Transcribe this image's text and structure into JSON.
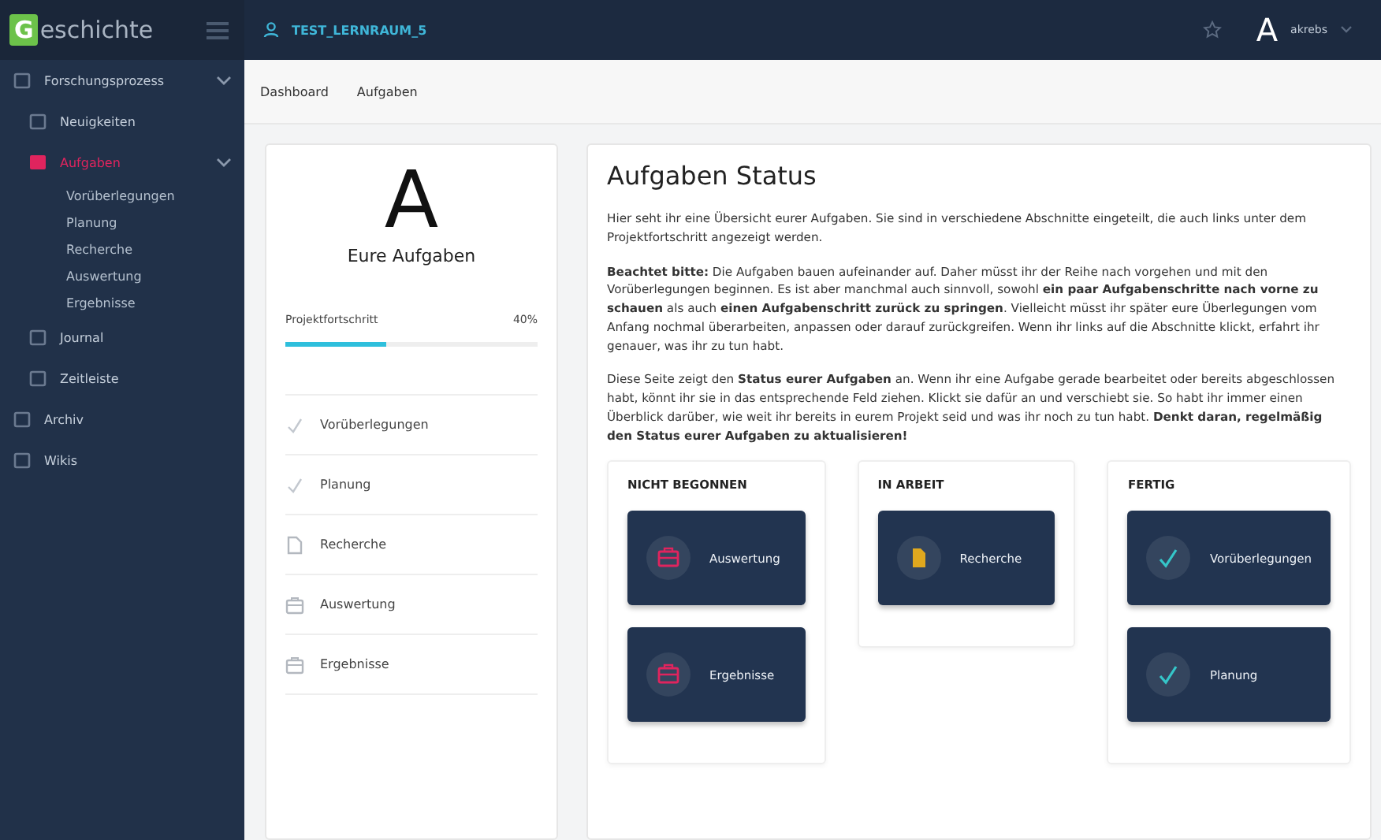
{
  "logo": {
    "initial": "G",
    "rest": "eschichte"
  },
  "topbar": {
    "room": "TEST_LERNRAUM_5",
    "avatar": "A",
    "user": "akrebs"
  },
  "sidebar": {
    "items": [
      {
        "label": "Forschungsprozess",
        "selected": false,
        "expanded": true,
        "children": [
          {
            "label": "Neuigkeiten",
            "selected": false
          },
          {
            "label": "Aufgaben",
            "selected": true,
            "expanded": true,
            "children": [
              {
                "label": "Vorüberlegungen",
                "selected": false
              },
              {
                "label": "Planung",
                "selected": false
              },
              {
                "label": "Recherche",
                "selected": false
              },
              {
                "label": "Auswertung",
                "selected": false
              },
              {
                "label": "Ergebnisse",
                "selected": false
              }
            ]
          },
          {
            "label": "Journal",
            "selected": false
          },
          {
            "label": "Zeitleiste",
            "selected": false
          }
        ]
      },
      {
        "label": "Archiv",
        "selected": false
      },
      {
        "label": "Wikis",
        "selected": false
      }
    ]
  },
  "breadcrumb": [
    "Dashboard",
    "Aufgaben"
  ],
  "summary": {
    "letter": "A",
    "title": "Eure Aufgaben",
    "progress_label": "Projektfortschritt",
    "progress_value": "40%",
    "level": 0.4,
    "tasks": [
      {
        "label": "Vorüberlegungen",
        "kind": "check"
      },
      {
        "label": "Planung",
        "kind": "check"
      },
      {
        "label": "Recherche",
        "kind": "file"
      },
      {
        "label": "Auswertung",
        "kind": "briefcase"
      },
      {
        "label": "Ergebnisse",
        "kind": "briefcase"
      }
    ]
  },
  "status": {
    "title": "Aufgaben Status",
    "paragraphs": [
      "Hier seht ihr eine Übersicht eurer Aufgaben. Sie sind in verschiedene Abschnitte eingeteilt, die auch links unter dem Projektfortschritt angezeigt werden.",
      "**Beachtet bitte:** Die Aufgaben bauen aufeinander auf. Daher müsst ihr der Reihe nach vorgehen und mit den Vorüberlegungen beginnen. Es ist aber manchmal auch sinnvoll, sowohl **ein paar Aufgabenschritte nach vorne zu schauen** als auch **einen Aufgabenschritt zurück zu springen**. Vielleicht müsst ihr später eure Überlegungen vom Anfang nochmal überarbeiten, anpassen oder darauf zurückgreifen. Wenn ihr links auf die Abschnitte klickt, erfahrt ihr genauer, was ihr zu tun habt.",
      "Diese Seite zeigt den **Status eurer Aufgaben** an. Wenn ihr eine Aufgabe gerade bearbeitet oder bereits abgeschlossen habt, könnt ihr sie in das entsprechende Feld ziehen. Klickt sie dafür an und verschiebt sie. So habt ihr immer einen Überblick darüber, wie weit ihr bereits in eurem Projekt seid und was ihr noch zu tun habt. **Denkt daran, regelmäßig den Status eurer Aufgaben zu aktualisieren!**"
    ],
    "columns": [
      {
        "title": "NICHT BEGONNEN",
        "cards": [
          {
            "label": "Auswertung",
            "kind": "briefcase"
          },
          {
            "label": "Ergebnisse",
            "kind": "briefcase"
          }
        ]
      },
      {
        "title": "IN ARBEIT",
        "cards": [
          {
            "label": "Recherche",
            "kind": "file"
          }
        ]
      },
      {
        "title": "FERTIG",
        "cards": [
          {
            "label": "Vorüberlegungen",
            "kind": "check"
          },
          {
            "label": "Planung",
            "kind": "check"
          }
        ]
      }
    ]
  }
}
